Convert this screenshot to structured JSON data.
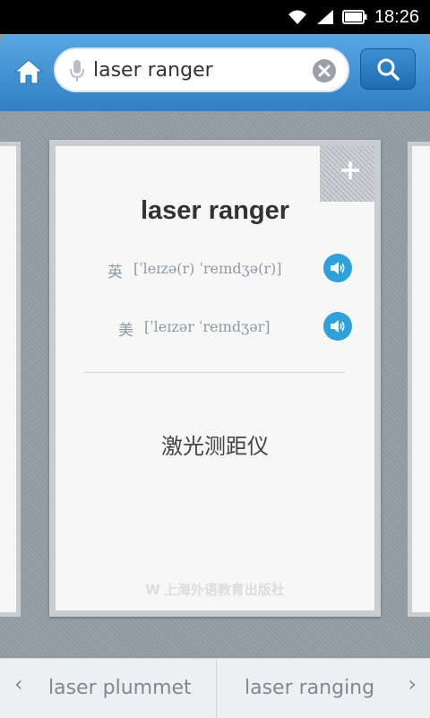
{
  "status_bar": {
    "time": "18:26"
  },
  "search": {
    "query": "laser ranger"
  },
  "card": {
    "word": "laser ranger",
    "uk": {
      "label": "英",
      "phonetic": "[ˈleɪzə(r) ˈreɪndʒə(r)]"
    },
    "us": {
      "label": "美",
      "phonetic": "[ˈleɪzər ˈreɪndʒər]"
    },
    "definition": "激光测距仪",
    "publisher": "上海外语教育出版社"
  },
  "bottom_nav": {
    "prev_label": "laser plummet",
    "next_label": "laser ranging"
  },
  "colors": {
    "accent_blue": "#2f80c6",
    "speaker_blue": "#2fa0d8"
  }
}
